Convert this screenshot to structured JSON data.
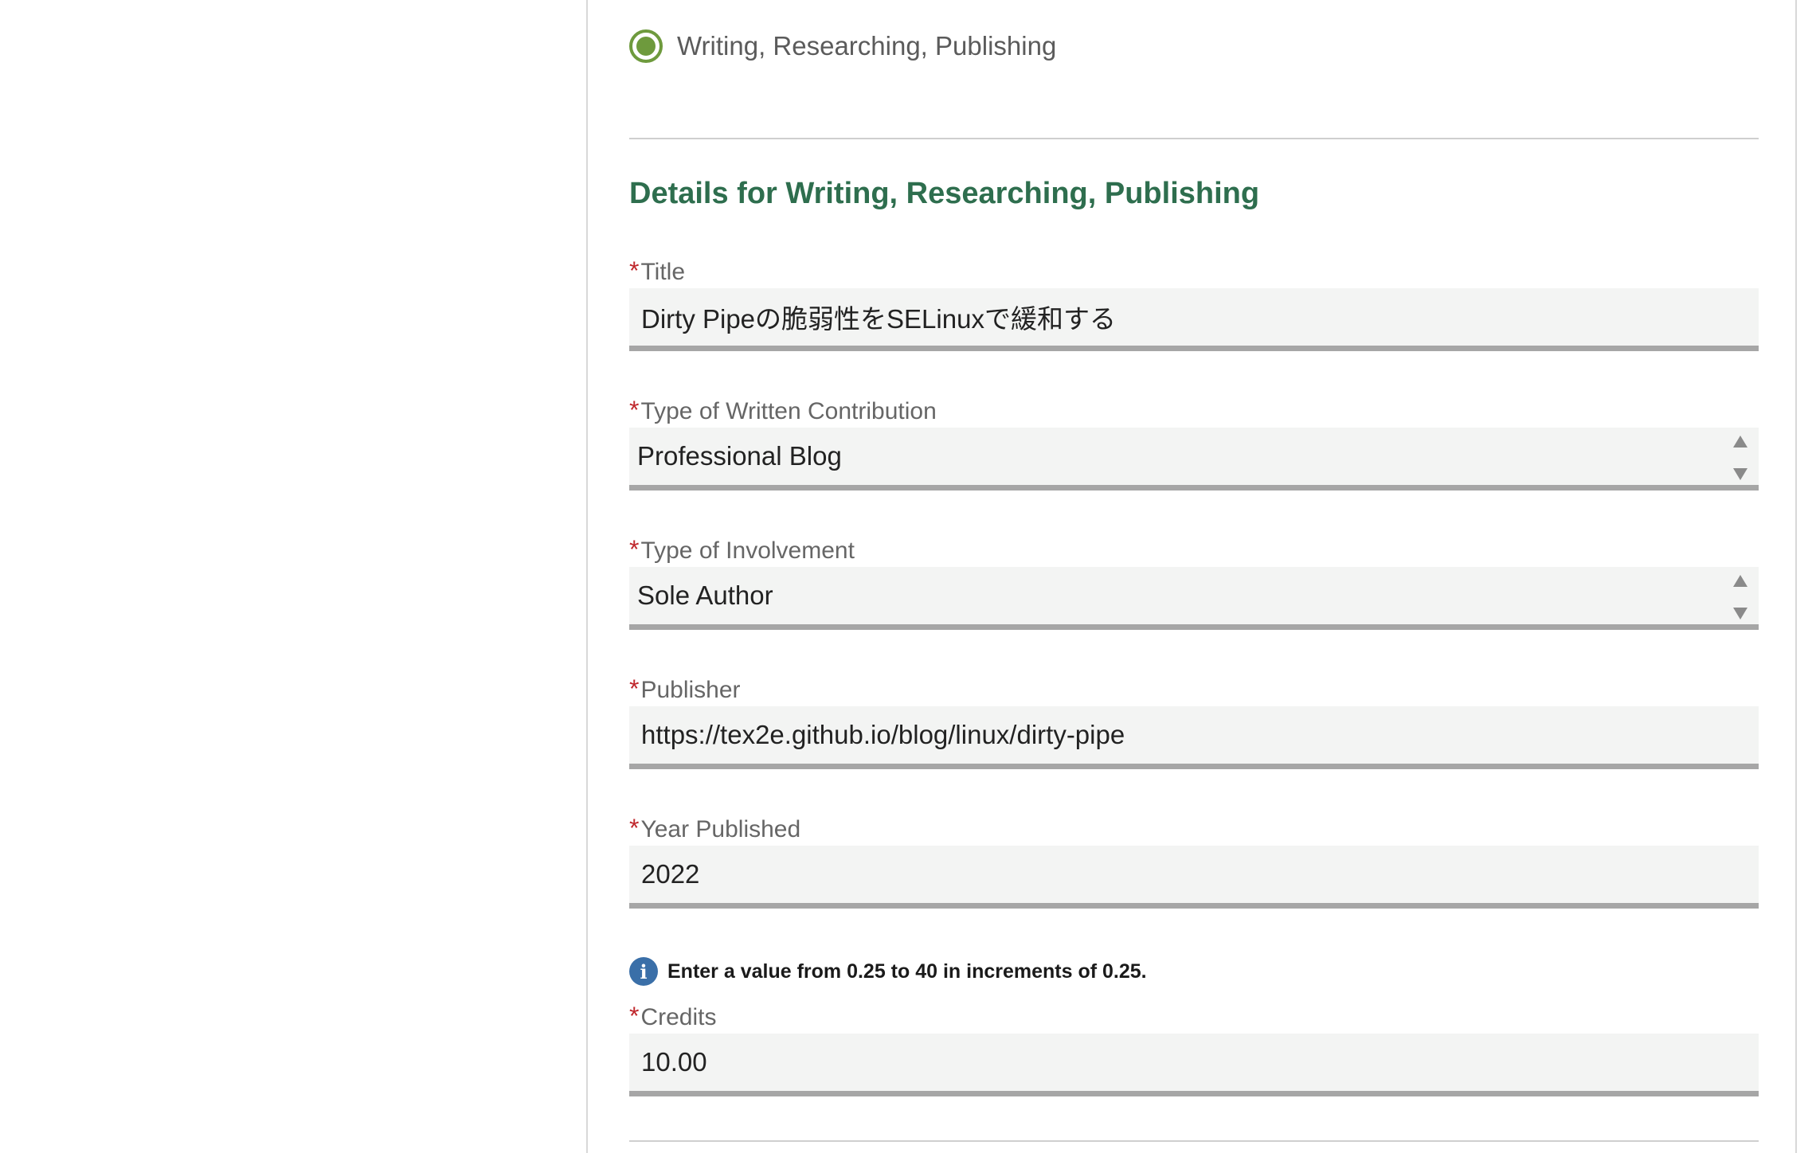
{
  "activity": {
    "selected_option": "Writing, Researching, Publishing",
    "radio_color": "#6e9a3d"
  },
  "details": {
    "title": "Details for Writing, Researching, Publishing",
    "title_color": "#2e6e4e"
  },
  "required_marker": "*",
  "fields": {
    "title": {
      "label": "Title",
      "value": "Dirty Pipeの脆弱性をSELinuxで緩和する"
    },
    "contribution_type": {
      "label": "Type of Written Contribution",
      "value": "Professional Blog"
    },
    "involvement_type": {
      "label": "Type of Involvement",
      "value": "Sole Author"
    },
    "publisher": {
      "label": "Publisher",
      "value": "https://tex2e.github.io/blog/linux/dirty-pipe"
    },
    "year_published": {
      "label": "Year Published",
      "value": "2022"
    },
    "credits": {
      "hint": "Enter a value from 0.25 to 40 in increments of 0.25.",
      "label": "Credits",
      "value": "10.00"
    }
  },
  "icons": {
    "radio": "radio-selected-icon",
    "info": "info-icon",
    "spinner_up": "triangle-up-icon",
    "spinner_down": "triangle-down-icon"
  },
  "info_icon_glyph": "i",
  "info_icon_color": "#3a6fa8",
  "required_color": "#c0282d"
}
